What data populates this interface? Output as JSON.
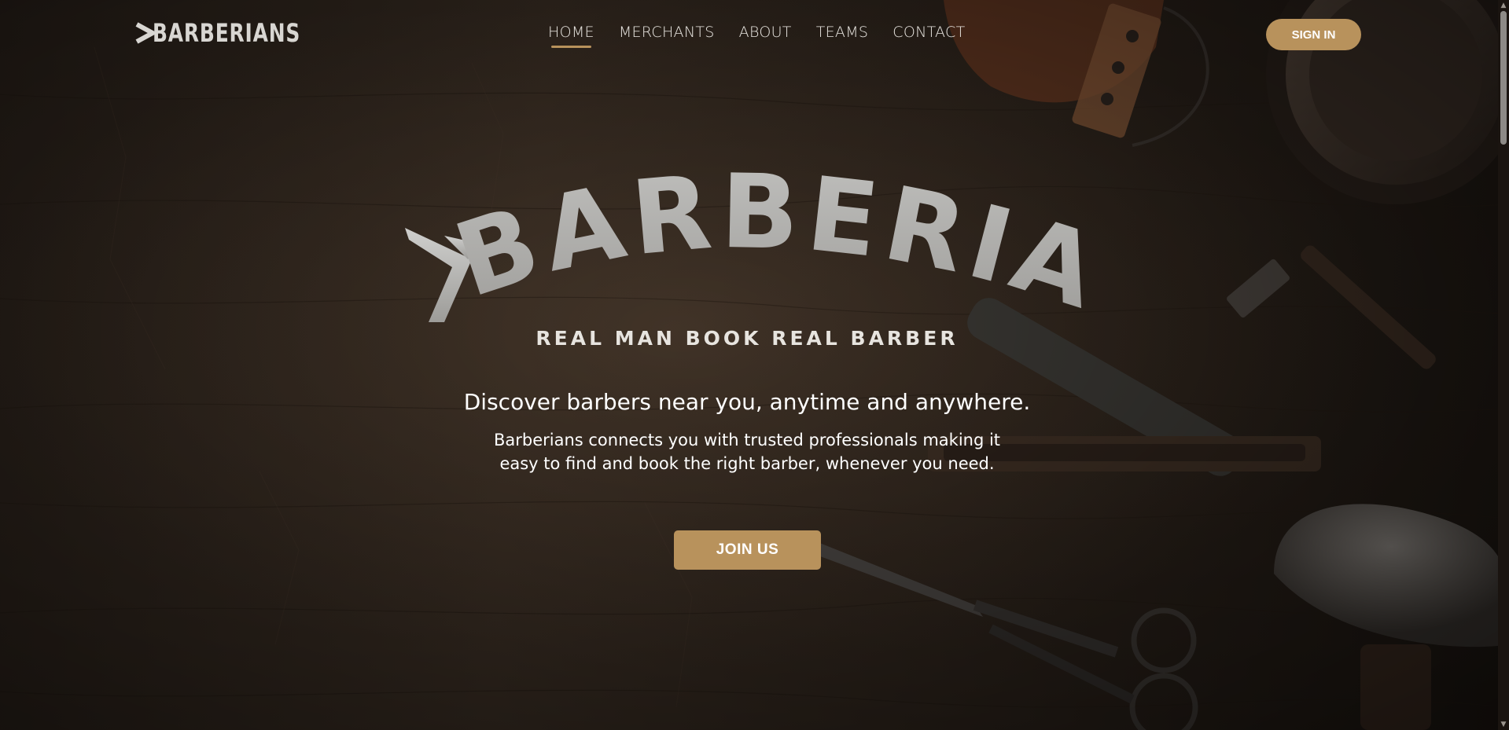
{
  "brand": {
    "logo_text": "BARBERIANS",
    "hero_wordmark": "BARBERIANS",
    "tagline": "REAL MAN BOOK REAL BARBER"
  },
  "nav": {
    "items": [
      {
        "label": "HOME",
        "active": true
      },
      {
        "label": "MERCHANTS",
        "active": false
      },
      {
        "label": "ABOUT",
        "active": false
      },
      {
        "label": "TEAMS",
        "active": false
      },
      {
        "label": "CONTACT",
        "active": false
      }
    ],
    "signin_label": "SIGN IN"
  },
  "hero": {
    "headline": "Discover barbers near you, anytime and anywhere.",
    "subtext": "Barberians connects you with trusted professionals making it easy to find and book the right barber, whenever you need.",
    "join_label": "JOIN US"
  },
  "colors": {
    "accent": "#b8925c",
    "background": "#2b221b",
    "text": "#ffffff"
  },
  "icons": {
    "scroll_up": "chevron-up-icon",
    "scroll_down": "chevron-down-icon"
  }
}
